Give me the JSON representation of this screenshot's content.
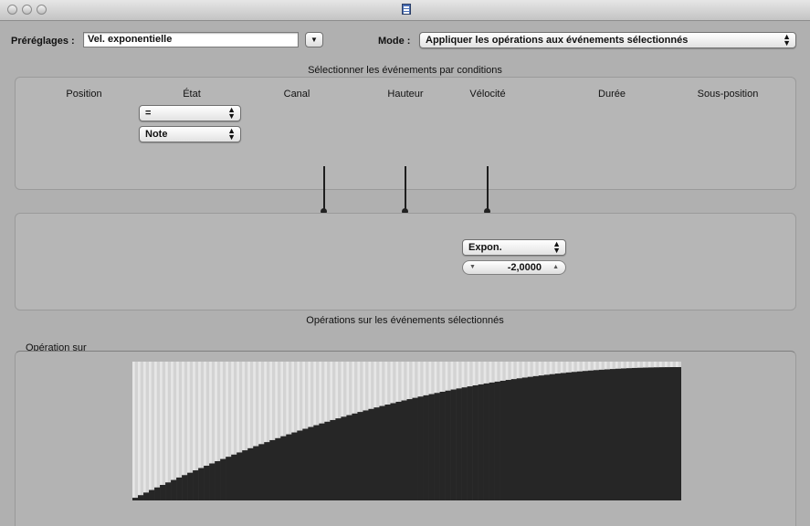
{
  "window": {
    "title_icon": "document-icon"
  },
  "top_bar": {
    "presets_label": "Préréglages :",
    "presets_value": "Vel. exponentielle",
    "mode_label": "Mode :",
    "mode_value": "Appliquer les opérations aux événements sélectionnés"
  },
  "selection": {
    "title": "Sélectionner les événements par conditions",
    "columns": [
      "Position",
      "État",
      "Canal",
      "Hauteur",
      "Vélocité",
      "Durée",
      "Sous-position"
    ],
    "state_condition": "=",
    "state_value": "Note"
  },
  "operations": {
    "velocity_operation": "Expon.",
    "velocity_value": "-2,0000",
    "title": "Opérations sur les événements sélectionnés"
  },
  "graph": {
    "label": "Opération sur",
    "bar_count": 100,
    "curve": "exponential",
    "exponent": -2.0
  },
  "colors": {
    "graph_fill": "#262626",
    "graph_bg": "#d3d3d3"
  }
}
